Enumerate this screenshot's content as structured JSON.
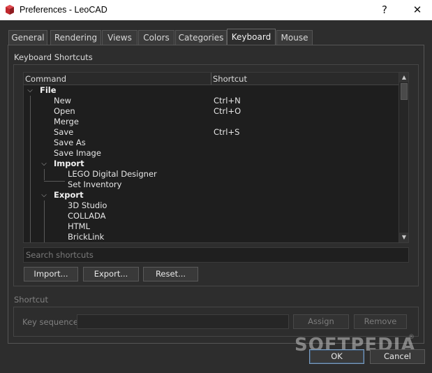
{
  "window": {
    "title": "Preferences - LeoCAD",
    "help_glyph": "?",
    "close_glyph": "✕",
    "icon": "leocad-brick-icon"
  },
  "tabs": [
    {
      "label": "General",
      "active": false
    },
    {
      "label": "Rendering",
      "active": false
    },
    {
      "label": "Views",
      "active": false
    },
    {
      "label": "Colors",
      "active": false
    },
    {
      "label": "Categories",
      "active": false
    },
    {
      "label": "Keyboard",
      "active": true
    },
    {
      "label": "Mouse",
      "active": false
    }
  ],
  "shortcuts_group": {
    "label": "Keyboard Shortcuts",
    "columns": {
      "command": "Command",
      "shortcut": "Shortcut"
    },
    "rows": [
      {
        "label": "File",
        "shortcut": "",
        "level": 0,
        "expandable": true
      },
      {
        "label": "New",
        "shortcut": "Ctrl+N",
        "level": 1,
        "expandable": false
      },
      {
        "label": "Open",
        "shortcut": "Ctrl+O",
        "level": 1,
        "expandable": false
      },
      {
        "label": "Merge",
        "shortcut": "",
        "level": 1,
        "expandable": false
      },
      {
        "label": "Save",
        "shortcut": "Ctrl+S",
        "level": 1,
        "expandable": false
      },
      {
        "label": "Save As",
        "shortcut": "",
        "level": 1,
        "expandable": false
      },
      {
        "label": "Save Image",
        "shortcut": "",
        "level": 1,
        "expandable": false
      },
      {
        "label": "Import",
        "shortcut": "",
        "level": 1,
        "expandable": true
      },
      {
        "label": "LEGO Digital Designer",
        "shortcut": "",
        "level": 2,
        "expandable": false
      },
      {
        "label": "Set Inventory",
        "shortcut": "",
        "level": 2,
        "expandable": false
      },
      {
        "label": "Export",
        "shortcut": "",
        "level": 1,
        "expandable": true
      },
      {
        "label": "3D Studio",
        "shortcut": "",
        "level": 2,
        "expandable": false
      },
      {
        "label": "COLLADA",
        "shortcut": "",
        "level": 2,
        "expandable": false
      },
      {
        "label": "HTML",
        "shortcut": "",
        "level": 2,
        "expandable": false
      },
      {
        "label": "BrickLink",
        "shortcut": "",
        "level": 2,
        "expandable": false
      }
    ],
    "search_placeholder": "Search shortcuts",
    "import_label": "Import...",
    "export_label": "Export...",
    "reset_label": "Reset..."
  },
  "shortcut_group": {
    "label": "Shortcut",
    "key_sequence_label": "Key sequence:",
    "key_sequence_value": "",
    "assign_label": "Assign",
    "remove_label": "Remove"
  },
  "dialog_buttons": {
    "ok_label": "OK",
    "cancel_label": "Cancel"
  },
  "watermark": {
    "text": "SOFTPEDIA",
    "mark": "®"
  }
}
